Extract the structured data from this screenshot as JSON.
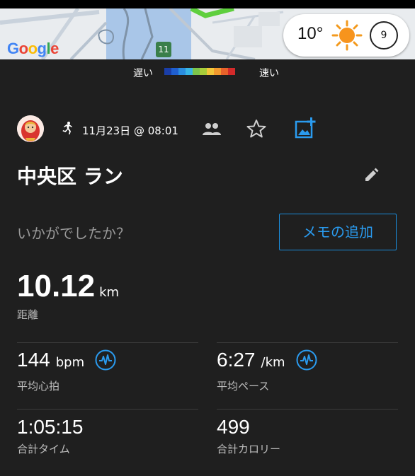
{
  "map": {
    "logo_letters": [
      "G",
      "o",
      "o",
      "g",
      "l",
      "e"
    ],
    "route_number": "11",
    "weather_temp": "10°",
    "weather_icon": "sun-icon",
    "weather_badge": "9"
  },
  "legend": {
    "slow_label": "遅い",
    "fast_label": "速い",
    "colors": [
      "#1a3ea8",
      "#1f5fd0",
      "#2a8de0",
      "#38b6e6",
      "#7cc54b",
      "#a7cd3a",
      "#f2c63a",
      "#f29a2e",
      "#e8622a",
      "#d32a2a"
    ]
  },
  "activity": {
    "type_icon": "running-icon",
    "datetime": "11月23日 @ 08:01",
    "title": "中央区 ラン",
    "prompt": "いかがでしたか？",
    "memo_button": "メモの追加"
  },
  "distance": {
    "value": "10.12",
    "unit": "km",
    "label": "距離"
  },
  "stats": {
    "avg_hr": {
      "value": "144",
      "unit": "bpm",
      "label": "平均心拍"
    },
    "avg_pace": {
      "value": "6:27",
      "unit": "/km",
      "label": "平均ペース"
    },
    "total_time": {
      "value": "1:05:15",
      "label": "合計タイム"
    },
    "total_calories": {
      "value": "499",
      "label": "合計カロリー"
    }
  },
  "colors": {
    "accent": "#2a9bef",
    "background": "#1f1f1f",
    "route": "#7ed957"
  }
}
